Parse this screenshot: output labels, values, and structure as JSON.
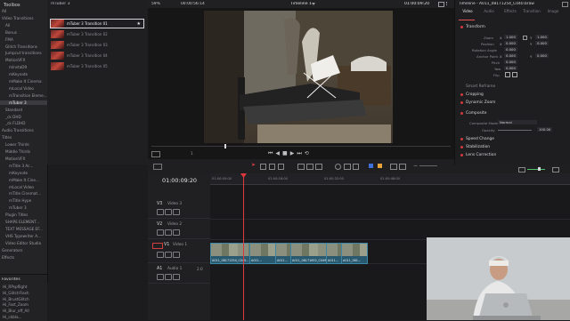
{
  "toolbox": {
    "title": "Toolbox",
    "items": [
      {
        "label": "All",
        "indent": 2
      },
      {
        "label": "Video Transitions",
        "indent": 2
      },
      {
        "label": "All",
        "indent": 6
      },
      {
        "label": "Bonus",
        "indent": 6
      },
      {
        "label": "FMA",
        "indent": 6
      },
      {
        "label": "Glitch Transitions",
        "indent": 6
      },
      {
        "label": "Jumpcut transitions",
        "indent": 6
      },
      {
        "label": "MotionVFX",
        "indent": 6
      },
      {
        "label": "mlnstaD9",
        "indent": 10
      },
      {
        "label": "mKeynote",
        "indent": 10
      },
      {
        "label": "mMake It Cinema",
        "indent": 10
      },
      {
        "label": "mLocal Video",
        "indent": 10
      },
      {
        "label": "mTransition Eleme...",
        "indent": 10
      },
      {
        "label": "mTuber 3",
        "indent": 10,
        "selected": true
      },
      {
        "label": "Standard",
        "indent": 6
      },
      {
        "label": "_ck DHD",
        "indent": 6
      },
      {
        "label": "_ck FLDHD",
        "indent": 6
      },
      {
        "label": "Audio Transitions",
        "indent": 2
      },
      {
        "label": "Titles",
        "indent": 2
      },
      {
        "label": "Lower Thirds",
        "indent": 6
      },
      {
        "label": "Middle Thirds",
        "indent": 6
      },
      {
        "label": "MotionVFX",
        "indent": 6
      },
      {
        "label": "mTitle 3 Ac...",
        "indent": 10
      },
      {
        "label": "mKeynote",
        "indent": 10
      },
      {
        "label": "mMake It Cine...",
        "indent": 10
      },
      {
        "label": "mLocal Video",
        "indent": 10
      },
      {
        "label": "mTitle Cinemat...",
        "indent": 10
      },
      {
        "label": "mTitle Hype",
        "indent": 10
      },
      {
        "label": "mTuber 3",
        "indent": 10
      },
      {
        "label": "Plugin Titles",
        "indent": 6
      },
      {
        "label": "SHAPE ELEMENT...",
        "indent": 6
      },
      {
        "label": "TEXT MESSAGE EF...",
        "indent": 6
      },
      {
        "label": "VHS Typewriter A...",
        "indent": 6
      },
      {
        "label": "Video Editor Studio",
        "indent": 6
      },
      {
        "label": "Generators",
        "indent": 2
      },
      {
        "label": "Effects",
        "indent": 2
      }
    ],
    "favorites_title": "Favorites",
    "favorites": [
      "Hi_RPspflight",
      "Hi_GlitchFlash",
      "Hi_BrustGlitch",
      "Hi_Fast_Zoom",
      "Hi_Blur_off_All",
      "Hi_ckbla..."
    ]
  },
  "fxlist": {
    "header": "mTuber 3",
    "items": [
      {
        "label": "mTuber 3 Transition 01",
        "selected": true
      },
      {
        "label": "mTuber 3 Transition 02"
      },
      {
        "label": "mTuber 3 Transition 03"
      },
      {
        "label": "mTuber 3 Transition 04"
      },
      {
        "label": "mTuber 3 Transition 05"
      }
    ]
  },
  "viewer": {
    "zoom": "59%",
    "source_timecode": "00:00:56:14",
    "timeline_name": "Timeline 1",
    "record_timecode": "01:00:09:20",
    "clip_name": "Timeline - A011_08171254_C040.braw",
    "page_number": "1"
  },
  "inspector": {
    "tabs": [
      "Video",
      "Audio",
      "Effects",
      "Transition",
      "Image"
    ],
    "active_tab": "Video",
    "sections": [
      {
        "label": "Transform"
      },
      {
        "label": "Smart Reframe",
        "collapsed": true
      },
      {
        "label": "Cropping"
      },
      {
        "label": "Dynamic Zoom"
      },
      {
        "label": "Composite"
      },
      {
        "label": "Speed Change"
      },
      {
        "label": "Stabilization"
      },
      {
        "label": "Lens Correction"
      }
    ],
    "transform": {
      "zoom_label": "Zoom",
      "zoom_x": "1.000",
      "zoom_y": "1.000",
      "position_label": "Position",
      "pos_x": "0.000",
      "pos_y": "0.000",
      "rotation_label": "Rotation Angle",
      "rotation": "0.000",
      "anchor_label": "Anchor Point",
      "anchor_x": "0.000",
      "anchor_y": "0.000",
      "pitch_label": "Pitch",
      "pitch": "0.000",
      "yaw_label": "Yaw",
      "yaw": "0.000",
      "flip_label": "Flip"
    },
    "composite": {
      "mode_label": "Composite Mode",
      "mode": "Normal",
      "opacity_label": "Opacity",
      "opacity": "100.00"
    }
  },
  "timeline": {
    "timecode": "01:00:09:20",
    "ruler": [
      "01:00:00:00",
      "01:00:16:00",
      "01:00:32:00",
      "01:00:48:00"
    ],
    "tracks": [
      {
        "id": "V3",
        "name": "Video 3"
      },
      {
        "id": "V2",
        "name": "Video 2"
      },
      {
        "id": "V1",
        "name": "Video 1"
      },
      {
        "id": "A1",
        "name": "Audio 1",
        "level": "2.0"
      }
    ],
    "clips": [
      {
        "label": "A011_08171254_C040..."
      },
      {
        "label": "A011..."
      },
      {
        "label": "A011..."
      },
      {
        "label": "A011_08171652_C049.b..."
      },
      {
        "label": "A011..."
      },
      {
        "label": "A011_081..."
      }
    ]
  }
}
